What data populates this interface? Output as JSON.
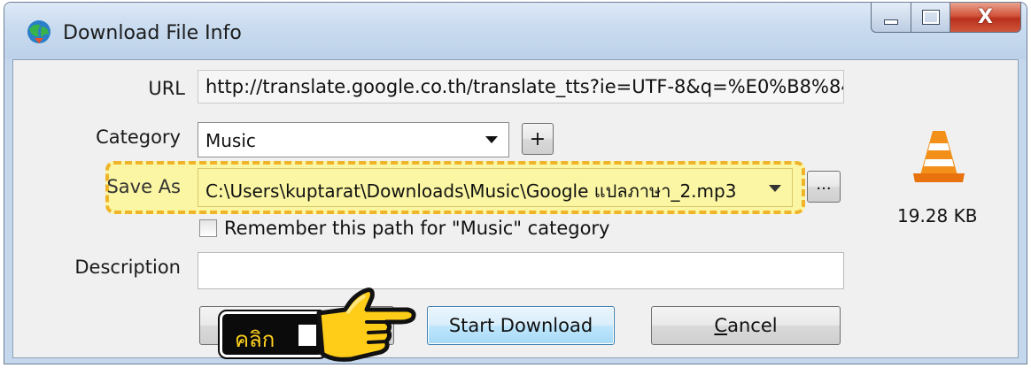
{
  "window": {
    "title": "Download File Info",
    "close_glyph": "X"
  },
  "form": {
    "url_label": "URL",
    "url_value": "http://translate.google.co.th/translate_tts?ie=UTF-8&q=%E0%B8%84%",
    "category_label": "Category",
    "category_value": "Music",
    "add_category_label": "+",
    "save_as_label": "Save As",
    "save_as_value": "C:\\Users\\kuptarat\\Downloads\\Music\\Google แปลภาษา_2.mp3",
    "browse_label": "...",
    "remember_label": "Remember this path for \"Music\" category",
    "remember_checked": false,
    "description_label": "Description",
    "description_value": ""
  },
  "file": {
    "size": "19.28 KB",
    "icon": "vlc-cone-icon"
  },
  "buttons": {
    "start": "Start Download",
    "cancel_rest": "ancel",
    "cancel_accel": "C"
  },
  "annotation": {
    "click_text": "คลิก",
    "highlight_color": "#f0b429",
    "hand_icon": "pointing-hand-icon"
  }
}
